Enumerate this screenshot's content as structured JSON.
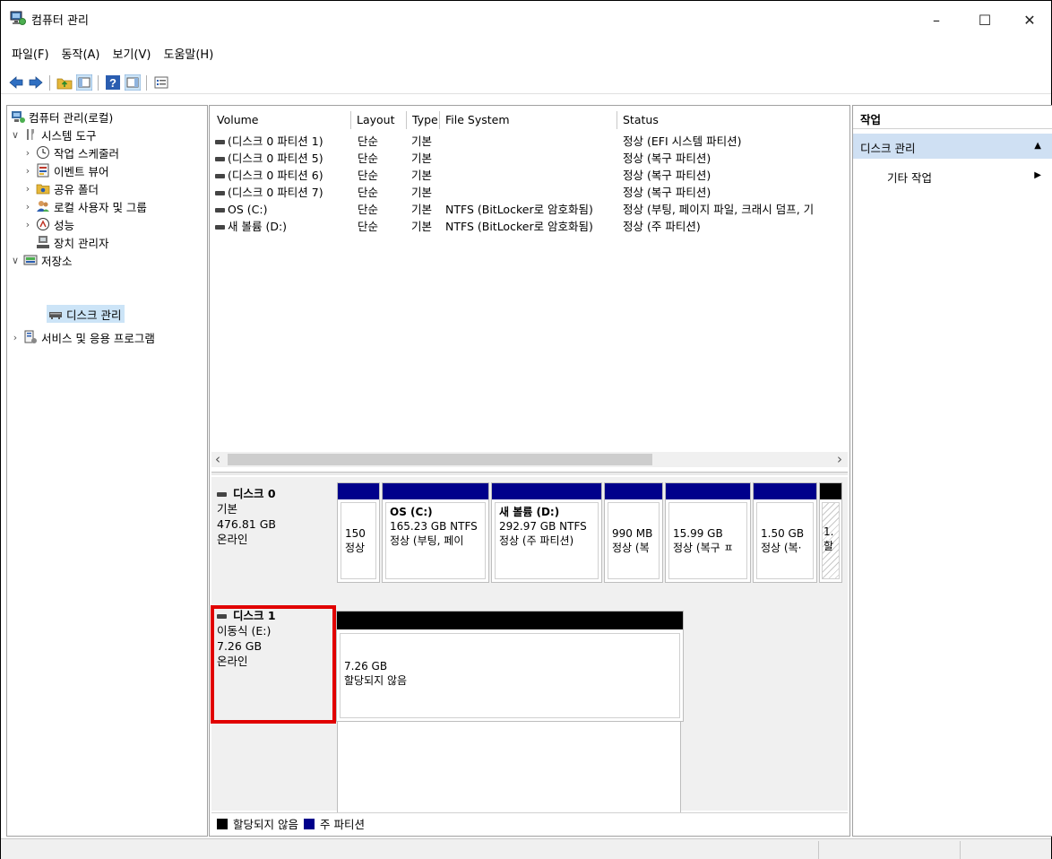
{
  "window": {
    "title": "컴퓨터 관리",
    "minimize": "–",
    "maximize": "☐",
    "close": "✕"
  },
  "menu": [
    "파일(F)",
    "동작(A)",
    "보기(V)",
    "도움말(H)"
  ],
  "tree": [
    {
      "label": "컴퓨터 관리(로컬)",
      "arrow": "",
      "icon": "computer-management-icon"
    },
    {
      "label": "시스템 도구",
      "arrow": "∨",
      "icon": "system-tools-icon"
    },
    {
      "label": "작업 스케줄러",
      "arrow": "›",
      "icon": "task-scheduler-icon"
    },
    {
      "label": "이벤트 뷰어",
      "arrow": "›",
      "icon": "event-viewer-icon"
    },
    {
      "label": "공유 폴더",
      "arrow": "›",
      "icon": "shared-folder-icon"
    },
    {
      "label": "로컬 사용자 및 그룹",
      "arrow": "›",
      "icon": "users-groups-icon"
    },
    {
      "label": "성능",
      "arrow": "›",
      "icon": "performance-icon"
    },
    {
      "label": "장치 관리자",
      "arrow": "",
      "icon": "device-manager-icon"
    },
    {
      "label": "저장소",
      "arrow": "∨",
      "icon": "storage-icon"
    },
    {
      "label": "디스크 관리",
      "arrow": "",
      "icon": "disk-management-icon"
    },
    {
      "label": "서비스 및 응용 프로그램",
      "arrow": "›",
      "icon": "services-apps-icon"
    }
  ],
  "volume_table": {
    "headers": [
      "Volume",
      "Layout",
      "Type",
      "File System",
      "Status"
    ],
    "rows": [
      [
        "(디스크 0 파티션 1)",
        "단순",
        "기본",
        "",
        "정상 (EFI 시스템 파티션)"
      ],
      [
        "(디스크 0 파티션 5)",
        "단순",
        "기본",
        "",
        "정상 (복구 파티션)"
      ],
      [
        "(디스크 0 파티션 6)",
        "단순",
        "기본",
        "",
        "정상 (복구 파티션)"
      ],
      [
        "(디스크 0 파티션 7)",
        "단순",
        "기본",
        "",
        "정상 (복구 파티션)"
      ],
      [
        "OS (C:)",
        "단순",
        "기본",
        "NTFS (BitLocker로 암호화됨)",
        "정상 (부팅, 페이지 파일, 크래시 덤프, 기"
      ],
      [
        "새 볼륨 (D:)",
        "단순",
        "기본",
        "NTFS (BitLocker로 암호화됨)",
        "정상 (주 파티션)"
      ]
    ]
  },
  "scroll": {
    "left": "‹",
    "right": "›"
  },
  "disk0": {
    "name": "디스크 0",
    "type": "기본",
    "size": "476.81 GB",
    "state": "온라인",
    "partitions": [
      {
        "title": "",
        "line1": "150",
        "line2": "정상"
      },
      {
        "title": "OS  (C:)",
        "line1": "165.23 GB NTFS",
        "line2": "정상 (부팅, 페이"
      },
      {
        "title": "새 볼륨  (D:)",
        "line1": "292.97 GB NTFS",
        "line2": "정상 (주 파티션)"
      },
      {
        "title": "",
        "line1": "990 MB",
        "line2": "정상 (복"
      },
      {
        "title": "",
        "line1": "15.99 GB",
        "line2": "정상 (복구 ㅍ"
      },
      {
        "title": "",
        "line1": "1.50 GB",
        "line2": "정상 (복·"
      },
      {
        "title": "",
        "line1": "1.",
        "line2": "할"
      }
    ]
  },
  "disk1": {
    "name": "디스크 1",
    "type": "이동식 (E:)",
    "size": "7.26 GB",
    "state": "온라인",
    "partition": {
      "line1": "7.26 GB",
      "line2": "할당되지 않음"
    }
  },
  "legend": {
    "unallocated": "할당되지 않음",
    "primary": "주 파티션"
  },
  "actions": {
    "header": "작업",
    "section": "디스크 관리",
    "item": "기타 작업",
    "section_arrow": "▲",
    "item_arrow": "▶"
  },
  "colors": {
    "primary_partition": "#00008b",
    "unallocated": "#000000",
    "highlight": "#e10000",
    "selection": "#cfe0f3"
  }
}
